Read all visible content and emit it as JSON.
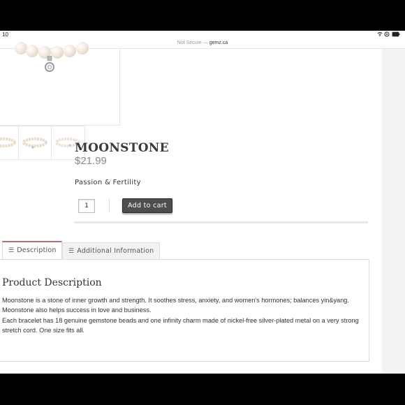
{
  "status_bar": {
    "time": "10",
    "icons": "▲ ◎ ▮"
  },
  "url_bar": {
    "security": "Not Secure —",
    "domain": "gemz.ca"
  },
  "product": {
    "title": "MOONSTONE",
    "price": "$21.99",
    "subtitle": "Passion & Fertility",
    "quantity": "1",
    "add_to_cart": "Add to cart"
  },
  "tabs": [
    {
      "label": "Description",
      "icon": "list-icon",
      "active": true
    },
    {
      "label": "Additional Information",
      "icon": "list-icon",
      "active": false
    }
  ],
  "description": {
    "heading": "Product Description",
    "paragraphs": [
      "Moonstone is a stone of inner growth and strength. It soothes stress, anxiety, and women's hormones; balances yin&yang. Moonstone also helps success in love and business.",
      "Each bracelet has 18 genuine gemstone beads and one infinity charm made of nickel-free silver-plated metal on a very strong stretch cord. One size fits all."
    ]
  },
  "colors": {
    "button_bg": "#4d4d4d",
    "tab_accent": "#b76f6f",
    "price": "#8a8a8a"
  }
}
